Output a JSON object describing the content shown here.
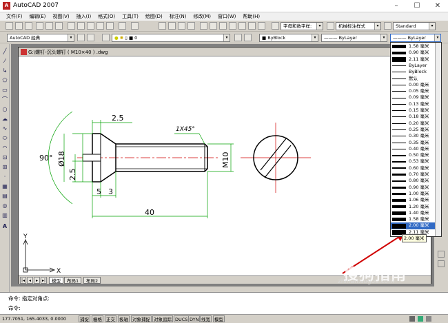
{
  "window": {
    "title": "AutoCAD 2007",
    "minimize": "–",
    "maximize": "☐",
    "close": "✕"
  },
  "menu": [
    "文件(F)",
    "编辑(E)",
    "视图(V)",
    "插入(I)",
    "格式(O)",
    "工具(T)",
    "绘图(D)",
    "标注(N)",
    "修改(M)",
    "窗口(W)",
    "帮助(H)"
  ],
  "toolbar1": {
    "text_style": "字母和数字样:",
    "dim_style": "机械标注样式",
    "table_style": "Standard"
  },
  "toolbar2": {
    "workspace": "AutoCAD 经典",
    "layer": "0",
    "color": "ByBlock",
    "linetype": "ByLayer",
    "lineweight": "ByLayer"
  },
  "document": {
    "title": "G:\\螺钉-沉头螺钉 ( M10×40 ) .dwg"
  },
  "drawing": {
    "dim_top": "2.5",
    "dim_chamfer": "1X45°",
    "dim_angle": "90°",
    "dim_head": "Ø18",
    "dim_small": "2.5",
    "dim_thread": "M10",
    "dim_5": "5",
    "dim_3": "3",
    "dim_length": "40",
    "axis_y": "Y",
    "axis_x": "X"
  },
  "lineweight_dropdown": {
    "items": [
      {
        "label": "1.58 毫米",
        "weight": 1.58
      },
      {
        "label": "0.90 毫米",
        "weight": 0.9
      },
      {
        "label": "2.11 毫米",
        "weight": 2.11
      },
      {
        "label": "ByLayer",
        "weight": 0
      },
      {
        "label": "ByBlock",
        "weight": 0
      },
      {
        "label": "默认",
        "weight": 0
      },
      {
        "label": "0.00 毫米",
        "weight": 0.0
      },
      {
        "label": "0.05 毫米",
        "weight": 0.05
      },
      {
        "label": "0.09 毫米",
        "weight": 0.09
      },
      {
        "label": "0.13 毫米",
        "weight": 0.13
      },
      {
        "label": "0.15 毫米",
        "weight": 0.15
      },
      {
        "label": "0.18 毫米",
        "weight": 0.18
      },
      {
        "label": "0.20 毫米",
        "weight": 0.2
      },
      {
        "label": "0.25 毫米",
        "weight": 0.25
      },
      {
        "label": "0.30 毫米",
        "weight": 0.3
      },
      {
        "label": "0.35 毫米",
        "weight": 0.35
      },
      {
        "label": "0.40 毫米",
        "weight": 0.4
      },
      {
        "label": "0.50 毫米",
        "weight": 0.5
      },
      {
        "label": "0.53 毫米",
        "weight": 0.53
      },
      {
        "label": "0.60 毫米",
        "weight": 0.6
      },
      {
        "label": "0.70 毫米",
        "weight": 0.7
      },
      {
        "label": "0.80 毫米",
        "weight": 0.8
      },
      {
        "label": "0.90 毫米",
        "weight": 0.9
      },
      {
        "label": "1.00 毫米",
        "weight": 1.0
      },
      {
        "label": "1.06 毫米",
        "weight": 1.06
      },
      {
        "label": "1.20 毫米",
        "weight": 1.2
      },
      {
        "label": "1.40 毫米",
        "weight": 1.4
      },
      {
        "label": "1.58 毫米",
        "weight": 1.58
      },
      {
        "label": "2.00 毫米",
        "weight": 2.0
      },
      {
        "label": "2.11 毫米",
        "weight": 2.11
      }
    ],
    "selected_index": 28,
    "tooltip": "2.00 毫米"
  },
  "tabs": [
    "模型",
    "布局1",
    "布局2"
  ],
  "command": {
    "line1": "命令: 指定对角点:",
    "line2": "命令:"
  },
  "status": {
    "coords": "177.7051, 165.4033, 0.0000",
    "buttons": [
      "捕捉",
      "栅格",
      "正交",
      "极轴",
      "对象捕捉",
      "对象追踪",
      "DUCS",
      "DYN",
      "线宽",
      "模型"
    ]
  },
  "watermark": {
    "line1": "搜狗指南",
    "line2": "zhinan.sogou.com"
  },
  "colors": {
    "red_line": "#d00000",
    "green_dim": "#00a000",
    "highlight": "#316ac5"
  }
}
